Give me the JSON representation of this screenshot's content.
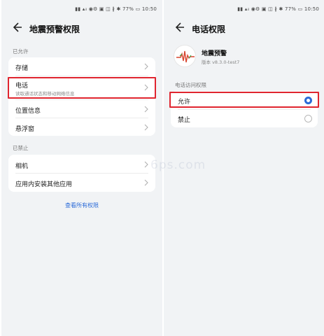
{
  "status_bar": {
    "text": "▮▮ ▴ᵢₗ ◉⚙   ▣ ◫ ∦ ✱ 77% ▭ 10:50",
    "battery": "77%",
    "time": "10:50"
  },
  "left_screen": {
    "title": "地震预警权限",
    "allowed_label": "已允许",
    "allowed_items": [
      {
        "label": "存储"
      },
      {
        "label": "电话",
        "sub": "读取通话状态和移动网络信息"
      },
      {
        "label": "位置信息"
      },
      {
        "label": "悬浮窗"
      }
    ],
    "denied_label": "已禁止",
    "denied_items": [
      {
        "label": "相机"
      },
      {
        "label": "应用内安装其他应用"
      }
    ],
    "view_all": "查看所有权限"
  },
  "right_screen": {
    "title": "电话权限",
    "app_name": "地震预警",
    "app_version": "版本 v8.3.0-test7",
    "section_label": "电话访问权限",
    "options": [
      {
        "label": "允许",
        "selected": true
      },
      {
        "label": "禁止",
        "selected": false
      }
    ]
  },
  "watermark": "6ps.com",
  "colors": {
    "accent": "#2a6ad8",
    "highlight": "#e0252f",
    "background": "#f1f3f5"
  },
  "icons": [
    "back-arrow-icon",
    "chevron-right-icon",
    "radio-selected-icon",
    "radio-unselected-icon",
    "app-logo-icon"
  ]
}
